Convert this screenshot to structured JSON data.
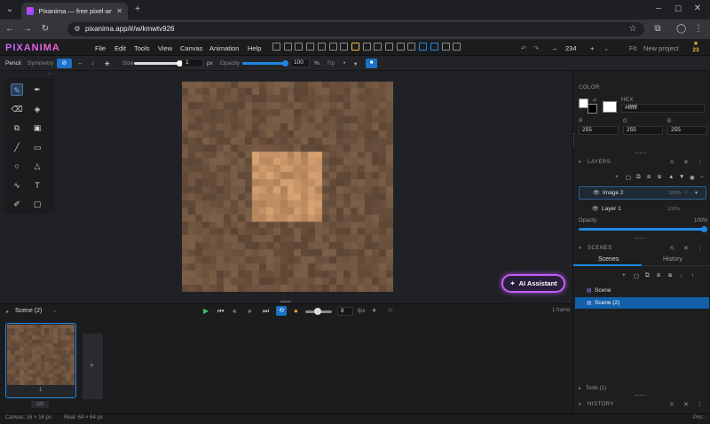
{
  "browser": {
    "tab_title": "Pixanima — free pixel-art & ani",
    "url": "pixanima.app/#/w/kmwtv926"
  },
  "app": {
    "logo": "PIXANIMA",
    "menu": [
      "File",
      "Edit",
      "Tools",
      "View",
      "Canvas",
      "Animation",
      "Help"
    ],
    "zoom": "234",
    "fit_label": "Fit",
    "new_project": "New project",
    "badge_count": "23"
  },
  "tool_options": {
    "tool_name": "Pencil",
    "symmetry_label": "Symmetry",
    "size_label": "Size",
    "size_value": "1",
    "size_unit": "px",
    "opacity_label": "Opacity",
    "opacity_value": "100",
    "opacity_unit": "%",
    "spacing_label": "7/p"
  },
  "tools": [
    "pencil",
    "pen",
    "eraser",
    "fill",
    "shape-select",
    "rect-select",
    "line",
    "rectangle",
    "ellipse",
    "triangle",
    "curve",
    "text",
    "eyedropper",
    "frame"
  ],
  "ai_button": "AI Assistant",
  "timeline": {
    "scene_label": "Scene (2)",
    "fps_value": "8",
    "fps_label": "fps",
    "frame_count": "1 frame",
    "frame_number": "1",
    "frame_duration": "125"
  },
  "status": {
    "canvas": "Canvas: 16 × 16 px",
    "real": "Real: 64 × 64 px",
    "pos": "Pos: -"
  },
  "color_panel": {
    "title": "COLOR",
    "hex_label": "HEX",
    "hex_value": "#ffffff",
    "r_label": "R",
    "g_label": "G",
    "b_label": "B",
    "r": "255",
    "g": "255",
    "b": "255"
  },
  "layers_panel": {
    "title": "LAYERS",
    "layers": [
      {
        "name": "Image 2",
        "opacity": "100%"
      },
      {
        "name": "Layer 1",
        "opacity": "100%"
      }
    ],
    "opacity_label": "Opacity",
    "opacity_value": "100%"
  },
  "scenes_panel": {
    "title": "SCENES",
    "tabs": [
      "Scenes",
      "History"
    ],
    "scenes": [
      "Scene",
      "Scene (2)"
    ],
    "tools_label": "Tools (1)",
    "history_title": "HISTORY"
  },
  "colors": {
    "accent": "#1a73c8",
    "ai_border": "#c45cf7",
    "inner_tile": "#c89466",
    "outer_tile": "#6e5340"
  }
}
